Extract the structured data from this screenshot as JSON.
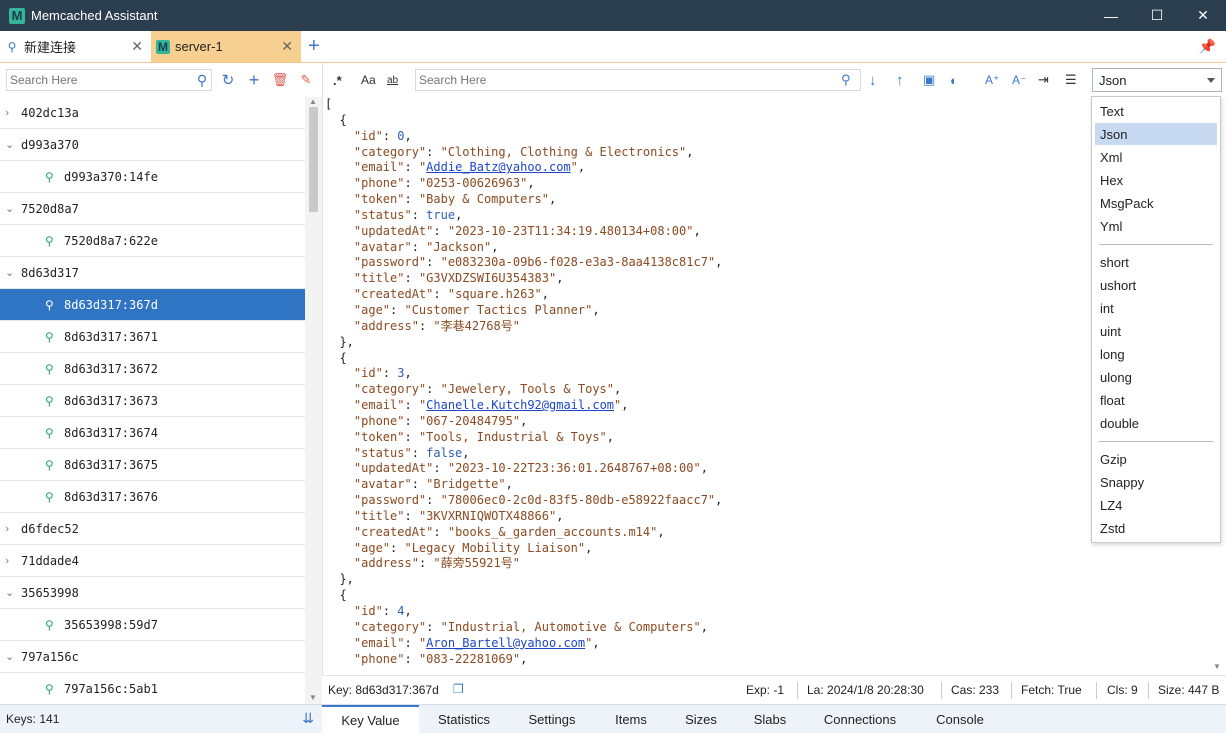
{
  "window": {
    "title": "Memcached Assistant",
    "logo_letter": "M",
    "controls": {
      "minimize": "—",
      "maximize": "☐",
      "close": "✕"
    }
  },
  "tabs": [
    {
      "label": "新建连接",
      "icon": "link-icon",
      "active": false
    },
    {
      "label": "server-1",
      "icon": "M",
      "active": true
    }
  ],
  "sidebar": {
    "search_placeholder": "Search Here",
    "tree": [
      {
        "label": "402dc13a",
        "type": "group"
      },
      {
        "label": "d993a370",
        "type": "group"
      },
      {
        "label": "d993a370:14fe",
        "type": "key"
      },
      {
        "label": "7520d8a7",
        "type": "group"
      },
      {
        "label": "7520d8a7:622e",
        "type": "key"
      },
      {
        "label": "8d63d317",
        "type": "group"
      },
      {
        "label": "8d63d317:367d",
        "type": "key",
        "selected": true
      },
      {
        "label": "8d63d317:3671",
        "type": "key"
      },
      {
        "label": "8d63d317:3672",
        "type": "key"
      },
      {
        "label": "8d63d317:3673",
        "type": "key"
      },
      {
        "label": "8d63d317:3674",
        "type": "key"
      },
      {
        "label": "8d63d317:3675",
        "type": "key"
      },
      {
        "label": "8d63d317:3676",
        "type": "key"
      },
      {
        "label": "d6fdec52",
        "type": "group"
      },
      {
        "label": "71ddade4",
        "type": "group"
      },
      {
        "label": "35653998",
        "type": "group"
      },
      {
        "label": "35653998:59d7",
        "type": "key"
      },
      {
        "label": "797a156c",
        "type": "group"
      },
      {
        "label": "797a156c:5ab1",
        "type": "key"
      }
    ],
    "keys_count": "Keys: 141"
  },
  "toolbar": {
    "regex_label": ".*",
    "case_label": "Aa",
    "word_label": "ab",
    "search_placeholder": "Search Here",
    "format_selected": "Json"
  },
  "json_records": [
    {
      "id": "0",
      "category": "\"Clothing, Clothing & Electronics\"",
      "email": "Addie_Batz@yahoo.com",
      "phone": "\"0253-00626963\"",
      "token": "\"Baby & Computers\"",
      "status": "true",
      "updatedAt": "\"2023-10-23T11:34:19.480134+08:00\"",
      "avatar": "\"Jackson\"",
      "password": "\"e083230a-09b6-f028-e3a3-8aa4138c81c7\"",
      "title": "\"G3VXDZSWI6U354383\"",
      "createdAt": "\"square.h263\"",
      "age": "\"Customer Tactics Planner\"",
      "address": "\"李巷42768号\""
    },
    {
      "id": "3",
      "category": "\"Jewelery, Tools & Toys\"",
      "email": "Chanelle.Kutch92@gmail.com",
      "phone": "\"067-20484795\"",
      "token": "\"Tools, Industrial & Toys\"",
      "status": "false",
      "updatedAt": "\"2023-10-22T23:36:01.2648767+08:00\"",
      "avatar": "\"Bridgette\"",
      "password": "\"78006ec0-2c0d-83f5-80db-e58922faacc7\"",
      "title": "\"3KVXRNIQWOTX48866\"",
      "createdAt": "\"books_&_garden_accounts.m14\"",
      "age": "\"Legacy Mobility Liaison\"",
      "address": "\"薛旁55921号\""
    },
    {
      "id": "4",
      "category": "\"Industrial, Automotive & Computers\"",
      "email": "Aron_Bartell@yahoo.com",
      "phone": "\"083-22281069\""
    }
  ],
  "value_status": {
    "key": "Key: 8d63d317:367d",
    "exp": "Exp: -1",
    "la": "La: 2024/1/8 20:28:30",
    "cas": "Cas: 233",
    "fetch": "Fetch: True",
    "cls": "Cls: 9",
    "size": "Size: 447 B"
  },
  "bottom_tabs": [
    "Key Value",
    "Statistics",
    "Settings",
    "Items",
    "Sizes",
    "Slabs",
    "Connections",
    "Console"
  ],
  "format_dropdown": {
    "group1": [
      "Text",
      "Json",
      "Xml",
      "Hex",
      "MsgPack",
      "Yml"
    ],
    "group2": [
      "short",
      "ushort",
      "int",
      "uint",
      "long",
      "ulong",
      "float",
      "double"
    ],
    "group3": [
      "Gzip",
      "Snappy",
      "LZ4",
      "Zstd"
    ],
    "selected": "Json"
  },
  "colors": {
    "titlebar": "#2b3e50",
    "active_tab": "#f7cf90",
    "selected_row": "#2f75c4",
    "accent": "#3a78c8",
    "json_key": "#8b4a21",
    "json_literal": "#2c5fb5"
  }
}
